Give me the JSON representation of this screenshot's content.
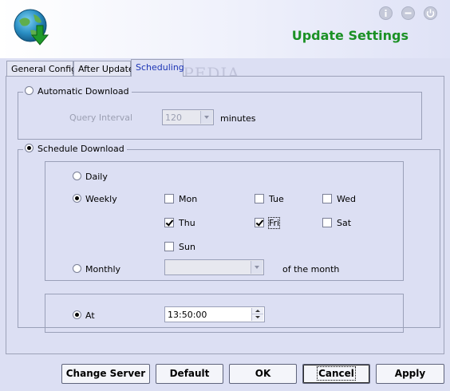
{
  "window": {
    "title": "Update Settings",
    "accent_color": "#1b9125",
    "controls": [
      "info-icon",
      "minimize-icon",
      "power-icon"
    ]
  },
  "watermark": {
    "text": "SOFTPEDIA",
    "url": "www.softpedia.com"
  },
  "tabs": [
    {
      "label": "General Config",
      "active": false
    },
    {
      "label": "After Update",
      "active": false
    },
    {
      "label": "Scheduling",
      "active": true
    }
  ],
  "automatic": {
    "radio_label": "Automatic Download",
    "selected": false,
    "query_label": "Query Interval",
    "query_value": "120",
    "unit": "minutes"
  },
  "schedule": {
    "radio_label": "Schedule Download",
    "selected": true,
    "daily_label": "Daily",
    "weekly_label": "Weekly",
    "monthly_label": "Monthly",
    "frequency": "Weekly",
    "days": {
      "mon": {
        "label": "Mon",
        "checked": false
      },
      "tue": {
        "label": "Tue",
        "checked": false
      },
      "wed": {
        "label": "Wed",
        "checked": false
      },
      "thu": {
        "label": "Thu",
        "checked": true
      },
      "fri": {
        "label": "Fri",
        "checked": true
      },
      "sat": {
        "label": "Sat",
        "checked": false
      },
      "sun": {
        "label": "Sun",
        "checked": false
      }
    },
    "month_day_value": "",
    "month_suffix": "of the month",
    "at_label": "At",
    "at_value": "13:50:00"
  },
  "buttons": {
    "change_server": "Change Server",
    "default": "Default",
    "ok": "OK",
    "cancel": "Cancel",
    "apply": "Apply"
  }
}
